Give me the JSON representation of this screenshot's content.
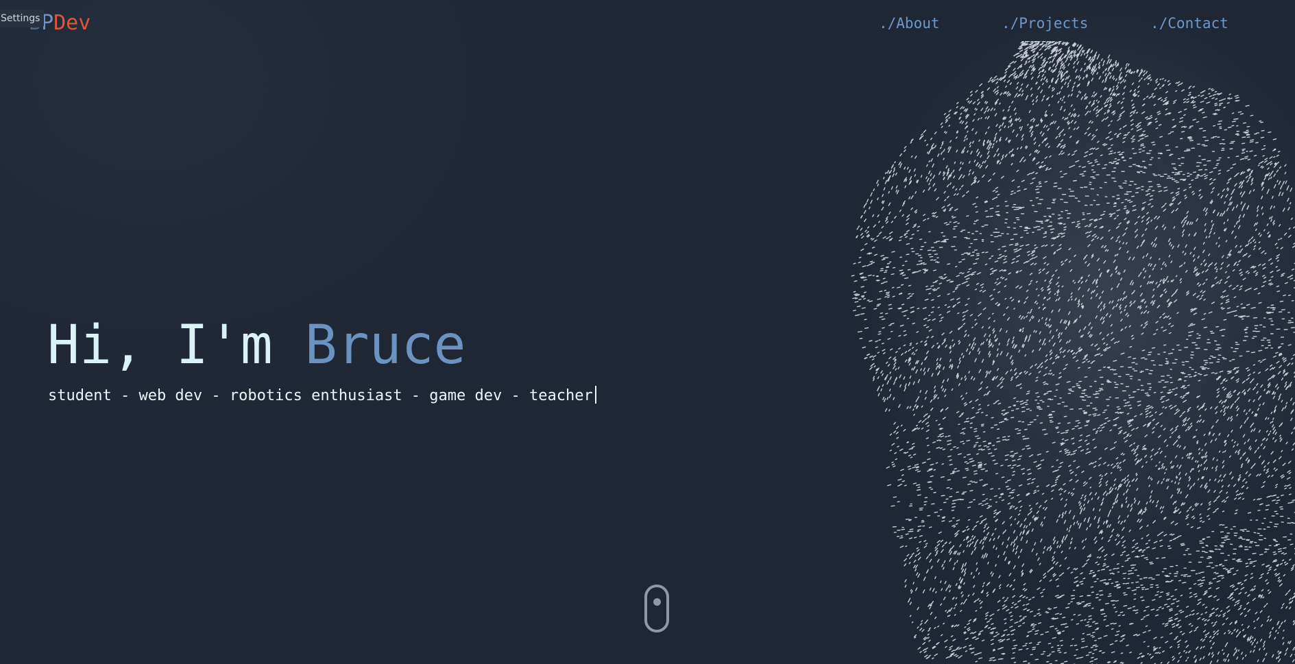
{
  "settings": {
    "label": "Settings"
  },
  "logo": {
    "part1": "B",
    "part2": "P",
    "part3": "Dev"
  },
  "nav": {
    "items": [
      {
        "label": "./About"
      },
      {
        "label": "./Projects"
      },
      {
        "label": "./Contact"
      }
    ]
  },
  "hero": {
    "greeting": "Hi, I'm ",
    "name": "Bruce",
    "tagline": "student - web dev - robotics enthusiast - game dev - teacher"
  },
  "colors": {
    "background": "#1f2735",
    "accent_blue": "#6a93c2",
    "accent_orange": "#e05638",
    "text_light": "#d9f3f6",
    "particles": "#e6ebf0"
  },
  "icons": {
    "scroll_indicator": "mouse-scroll-icon"
  }
}
